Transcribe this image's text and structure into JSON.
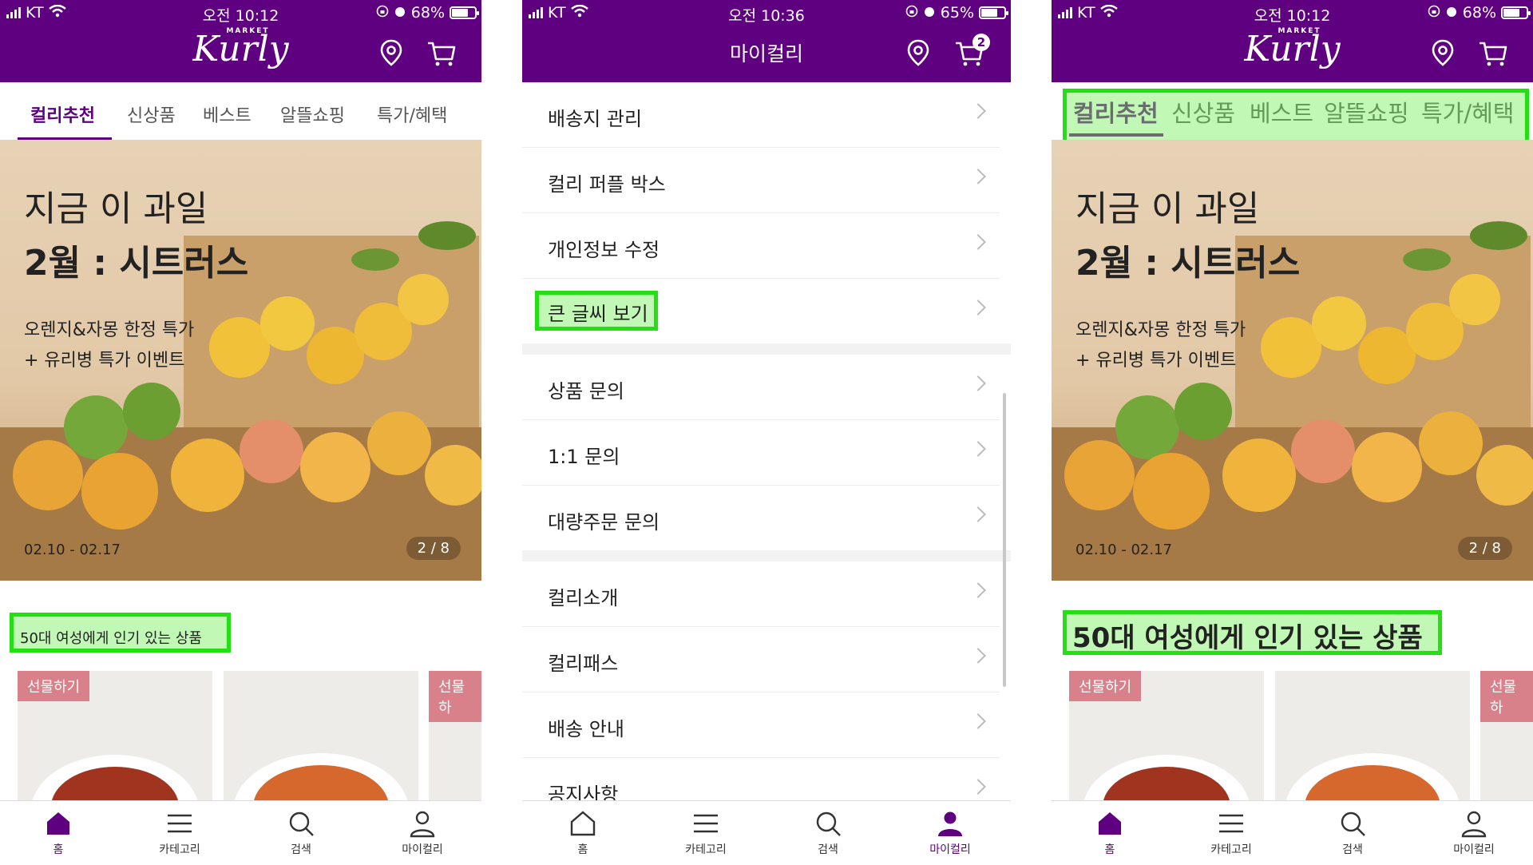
{
  "panel1": {
    "status": {
      "carrier": "KT",
      "time": "오전 10:12",
      "battery": "68%",
      "battery_level": 0.68
    },
    "logo": {
      "small": "MARKET",
      "big": "Kurly"
    },
    "tabs": [
      {
        "label": "컬리추천"
      },
      {
        "label": "신상품"
      },
      {
        "label": "베스트"
      },
      {
        "label": "알뜰쇼핑"
      },
      {
        "label": "특가/혜택"
      }
    ],
    "banner": {
      "line1": "지금 이 과일",
      "line2": "2월 : 시트러스",
      "line3": "오렌지&자몽 한정 특가",
      "line4": "+ 유리병 특가 이벤트",
      "date": "02.10 - 02.17",
      "page": "2 / 8"
    },
    "section_title": "50대 여성에게 인기 있는 상품",
    "gift_label": "선물하기",
    "gift_label_cut": "선물하"
  },
  "panel2": {
    "status": {
      "carrier": "KT",
      "time": "오전 10:36",
      "battery": "65%",
      "battery_level": 0.65
    },
    "title": "마이컬리",
    "cart_count": "2",
    "menu_group1": [
      {
        "label": "배송지 관리"
      },
      {
        "label": "컬리 퍼플 박스"
      },
      {
        "label": "개인정보 수정"
      },
      {
        "label": "큰 글씨 보기"
      }
    ],
    "menu_group2": [
      {
        "label": "상품 문의"
      },
      {
        "label": "1:1 문의"
      },
      {
        "label": "대량주문 문의"
      }
    ],
    "menu_group3": [
      {
        "label": "컬리소개"
      },
      {
        "label": "컬리패스"
      },
      {
        "label": "배송 안내"
      },
      {
        "label": "공지사항"
      }
    ]
  },
  "panel3": {
    "status": {
      "carrier": "KT",
      "time": "오전 10:12",
      "battery": "68%",
      "battery_level": 0.68
    },
    "logo": {
      "small": "MARKET",
      "big": "Kurly"
    },
    "tabs": [
      {
        "label": "컬리추천"
      },
      {
        "label": "신상품"
      },
      {
        "label": "베스트"
      },
      {
        "label": "알뜰쇼핑"
      },
      {
        "label": "특가/혜택"
      }
    ],
    "banner": {
      "line1": "지금 이 과일",
      "line2": "2월 : 시트러스",
      "line3": "오렌지&자몽 한정 특가",
      "line4": "+ 유리병 특가 이벤트",
      "date": "02.10 - 02.17",
      "page": "2 / 8"
    },
    "section_title": "50대 여성에게 인기 있는 상품",
    "gift_label": "선물하기",
    "gift_label_cut": "선물하"
  },
  "nav": {
    "home": "홈",
    "category": "카테고리",
    "search": "검색",
    "my": "마이컬리"
  },
  "colors": {
    "brand_purple": "#5f0080",
    "highlight_green": "#22e012",
    "gift_pink": "#d9818a"
  }
}
